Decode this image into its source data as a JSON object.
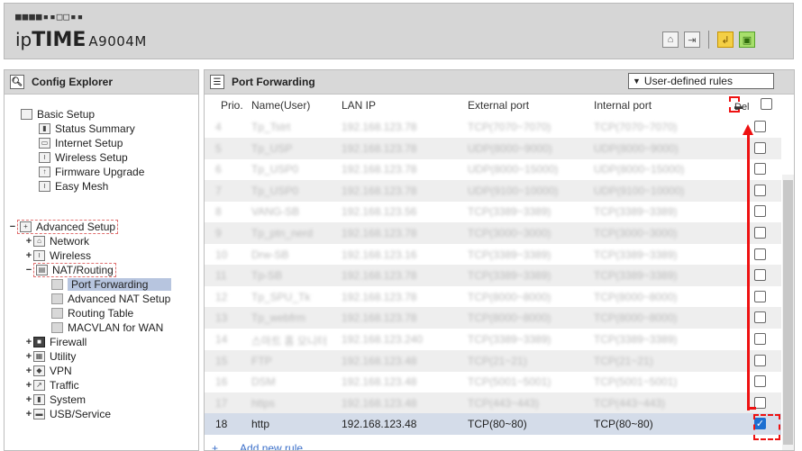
{
  "header": {
    "logo_dots": "■■■■▪▪□□▪▪",
    "brand_prefix": "ip",
    "brand_main": "TIME",
    "model": "A9004M",
    "icons": [
      "home-icon",
      "logout-icon",
      "restore-icon",
      "save-icon"
    ]
  },
  "left": {
    "title": "Config Explorer",
    "tree": [
      {
        "label": "Basic Setup",
        "exp": "",
        "level": 0
      },
      {
        "label": "Status Summary",
        "exp": "",
        "level": 1
      },
      {
        "label": "Internet Setup",
        "exp": "",
        "level": 1
      },
      {
        "label": "Wireless Setup",
        "exp": "",
        "level": 1
      },
      {
        "label": "Firmware Upgrade",
        "exp": "",
        "level": 1
      },
      {
        "label": "Easy Mesh",
        "exp": "",
        "level": 1
      },
      {
        "label": "Advanced Setup",
        "exp": "−",
        "level": 0
      },
      {
        "label": "Network",
        "exp": "+",
        "level": 1
      },
      {
        "label": "Wireless",
        "exp": "+",
        "level": 1
      },
      {
        "label": "NAT/Routing",
        "exp": "−",
        "level": 1
      },
      {
        "label": "Port Forwarding",
        "exp": "",
        "level": 2
      },
      {
        "label": "Advanced NAT Setup",
        "exp": "",
        "level": 2
      },
      {
        "label": "Routing Table",
        "exp": "",
        "level": 2
      },
      {
        "label": "MACVLAN for WAN",
        "exp": "",
        "level": 2
      },
      {
        "label": "Firewall",
        "exp": "+",
        "level": 1
      },
      {
        "label": "Utility",
        "exp": "+",
        "level": 1
      },
      {
        "label": "VPN",
        "exp": "+",
        "level": 1
      },
      {
        "label": "Traffic",
        "exp": "+",
        "level": 1
      },
      {
        "label": "System",
        "exp": "+",
        "level": 1
      },
      {
        "label": "USB/Service",
        "exp": "+",
        "level": 1
      }
    ]
  },
  "right": {
    "title": "Port Forwarding",
    "filter_select": "User-defined rules",
    "columns": {
      "prio": "Prio.",
      "name": "Name(User)",
      "lan_ip": "LAN IP",
      "external": "External port",
      "internal": "Internal port",
      "del": "Del"
    },
    "rows": [
      {
        "prio": "4",
        "name": "Tp_Tstrt",
        "ip": "192.168.123.78",
        "ext": "TCP(7070~7070)",
        "int": "TCP(7070~7070)",
        "blur": true
      },
      {
        "prio": "5",
        "name": "Tp_USP",
        "ip": "192.168.123.78",
        "ext": "UDP(8000~9000)",
        "int": "UDP(8000~9000)",
        "blur": true
      },
      {
        "prio": "6",
        "name": "Tp_USP0",
        "ip": "192.168.123.78",
        "ext": "UDP(8000~15000)",
        "int": "UDP(8000~15000)",
        "blur": true
      },
      {
        "prio": "7",
        "name": "Tp_USP0",
        "ip": "192.168.123.78",
        "ext": "UDP(9100~10000)",
        "int": "UDP(9100~10000)",
        "blur": true
      },
      {
        "prio": "8",
        "name": "VANG-SB",
        "ip": "192.168.123.56",
        "ext": "TCP(3389~3389)",
        "int": "TCP(3389~3389)",
        "blur": true
      },
      {
        "prio": "9",
        "name": "Tp_ptn_nerd",
        "ip": "192.168.123.78",
        "ext": "TCP(3000~3000)",
        "int": "TCP(3000~3000)",
        "blur": true
      },
      {
        "prio": "10",
        "name": "Drw-SB",
        "ip": "192.168.123.16",
        "ext": "TCP(3389~3389)",
        "int": "TCP(3389~3389)",
        "blur": true
      },
      {
        "prio": "11",
        "name": "Tp-SB",
        "ip": "192.168.123.78",
        "ext": "TCP(3389~3389)",
        "int": "TCP(3389~3389)",
        "blur": true
      },
      {
        "prio": "12",
        "name": "Tp_SPU_Tk",
        "ip": "192.168.123.78",
        "ext": "TCP(8000~8000)",
        "int": "TCP(8000~8000)",
        "blur": true
      },
      {
        "prio": "13",
        "name": "Tp_webfrm",
        "ip": "192.168.123.78",
        "ext": "TCP(8000~8000)",
        "int": "TCP(8000~8000)",
        "blur": true
      },
      {
        "prio": "14",
        "name": "스마트 홈 모니터",
        "ip": "192.168.123.240",
        "ext": "TCP(3389~3389)",
        "int": "TCP(3389~3389)",
        "blur": true
      },
      {
        "prio": "15",
        "name": "FTP",
        "ip": "192.168.123.48",
        "ext": "TCP(21~21)",
        "int": "TCP(21~21)",
        "blur": true
      },
      {
        "prio": "16",
        "name": "DSM",
        "ip": "192.168.123.48",
        "ext": "TCP(5001~5001)",
        "int": "TCP(5001~5001)",
        "blur": true
      },
      {
        "prio": "17",
        "name": "https",
        "ip": "192.168.123.48",
        "ext": "TCP(443~443)",
        "int": "TCP(443~443)",
        "blur": true
      },
      {
        "prio": "18",
        "name": "http",
        "ip": "192.168.123.48",
        "ext": "TCP(80~80)",
        "int": "TCP(80~80)",
        "blur": false
      }
    ],
    "add_rule": "Add new rule",
    "add_icon": "+"
  }
}
